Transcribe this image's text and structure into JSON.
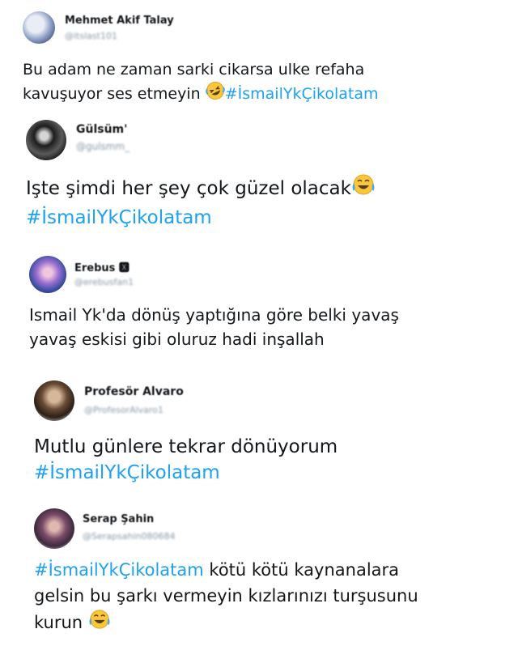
{
  "tweets": [
    {
      "name": "Mehmet Akif Talay",
      "handle": "@itslast101",
      "line1": "Bu adam ne zaman sarki cikarsa ulke refaha",
      "line2_text": "kavuşuyor ses etmeyin ",
      "emoji": "rolling-on-floor-laughing",
      "hashtag": "#İsmailYkÇikolatam"
    },
    {
      "name": "Gülsüm'",
      "handle": "@gulsmm_",
      "line1_text": "Işte şimdi her şey çok güzel olacak",
      "emoji": "face-with-tears-of-joy",
      "hashtag": "#İsmailYkÇikolatam"
    },
    {
      "name": "Erebus 🆇",
      "handle": "@erebusfan1",
      "line1": "Ismail Yk'da dönüş yaptığına göre belki yavaş",
      "line2": "yavaş eskisi gibi oluruz hadi inşallah"
    },
    {
      "name": "Profesör Alvaro",
      "handle": "@ProfesorAlvaro1",
      "line1": "Mutlu günlere tekrar dönüyorum",
      "hashtag": "#İsmailYkÇikolatam"
    },
    {
      "name": "Serap Şahin",
      "handle": "@Serapsahin080684",
      "hashtag": "#İsmailYkÇikolatam",
      "line1_rest": " kötü kötü kaynanalara",
      "line2": "gelsin bu şarkı vermeyin kızlarınızı turşusunu",
      "line3_text": "kurun ",
      "emoji": "face-with-tears-of-joy"
    }
  ]
}
